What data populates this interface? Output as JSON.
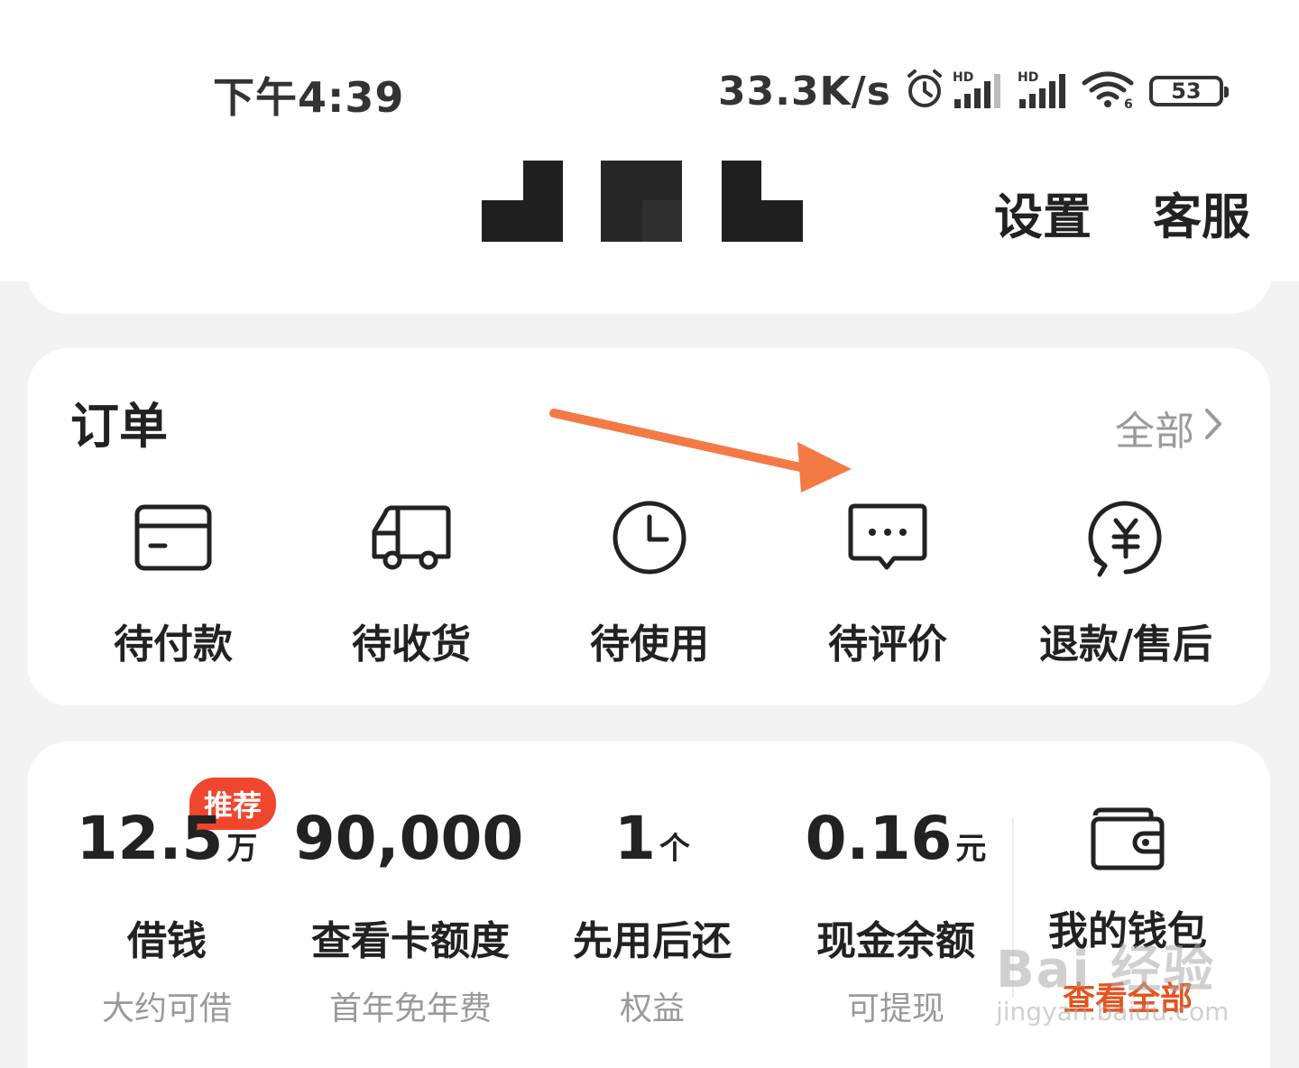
{
  "status_bar": {
    "time": "下午4:39",
    "net_speed": "33.3K/s",
    "battery": "53",
    "icons": [
      "alarm-icon",
      "hd-signal-icon",
      "hd-signal-icon",
      "wifi-icon",
      "battery-icon"
    ]
  },
  "header": {
    "settings": "设置",
    "service": "客服"
  },
  "orders": {
    "title": "订单",
    "all_label": "全部",
    "items": [
      {
        "label": "待付款",
        "icon": "card-icon"
      },
      {
        "label": "待收货",
        "icon": "truck-icon"
      },
      {
        "label": "待使用",
        "icon": "clock-icon"
      },
      {
        "label": "待评价",
        "icon": "comment-icon"
      },
      {
        "label": "退款/售后",
        "icon": "refund-yuan-icon"
      }
    ]
  },
  "finance": {
    "badge": "推荐",
    "items": [
      {
        "value": "12.5",
        "unit": "万",
        "label": "借钱",
        "sub": "大约可借"
      },
      {
        "value": "90,000",
        "unit": "",
        "label": "查看卡额度",
        "sub": "首年免年费"
      },
      {
        "value": "1",
        "unit": "个",
        "label": "先用后还",
        "sub": "权益"
      },
      {
        "value": "0.16",
        "unit": "元",
        "label": "现金余额",
        "sub": "可提现"
      }
    ],
    "wallet": {
      "label": "我的钱包",
      "sub": "查看全部",
      "icon": "wallet-icon"
    }
  },
  "colors": {
    "accent": "#f0462e",
    "annotation_arrow": "#f47a45",
    "muted_text": "#9a9a9a"
  },
  "watermark": {
    "main": "Bai 经验",
    "url": "jingyan.baidu.com"
  }
}
